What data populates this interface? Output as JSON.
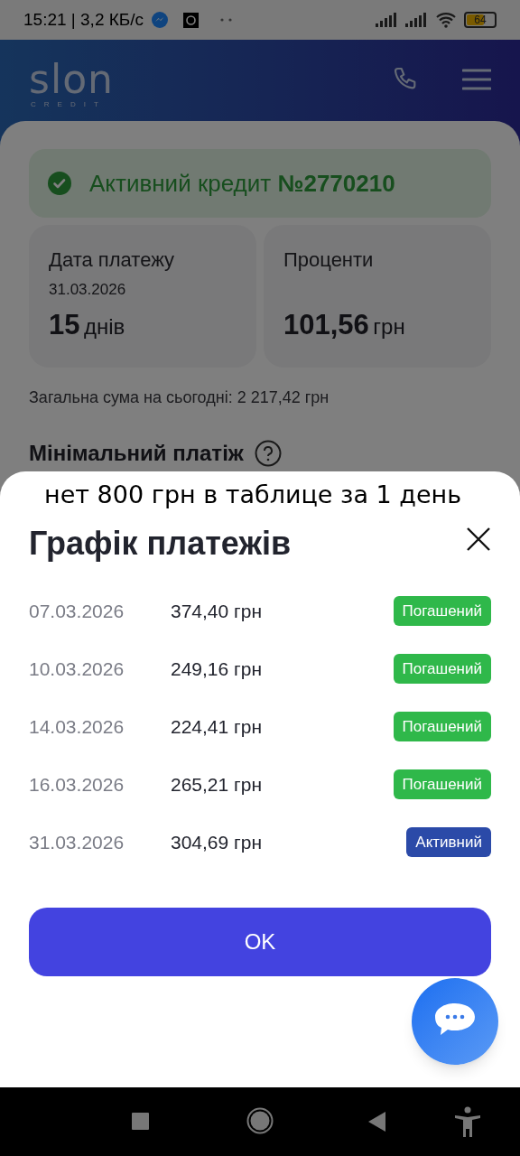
{
  "status_bar": {
    "time": "15:21 | 3,2 КБ/с",
    "battery": "64"
  },
  "header": {
    "logo": "slon",
    "logo_sub": "CREDIT"
  },
  "loan": {
    "label": "Активний кредит",
    "number": "№2770210"
  },
  "cards": [
    {
      "title": "Дата платежу",
      "subtitle": "31.03.2026",
      "value": "15",
      "unit": "днів"
    },
    {
      "title": "Проценти",
      "value": "101,56",
      "unit": "грн"
    }
  ],
  "total": "Загальна сума на сьогодні: 2 217,42 грн",
  "section_title": "Мінімальний платіж",
  "sheet": {
    "annotation": "нет 800 грн в таблице за  1 день",
    "title": "Графік платежів",
    "rows": [
      {
        "date": "07.03.2026",
        "amount": "374,40 грн",
        "status": "Погашений",
        "kind": "paid"
      },
      {
        "date": "10.03.2026",
        "amount": "249,16 грн",
        "status": "Погашений",
        "kind": "paid"
      },
      {
        "date": "14.03.2026",
        "amount": "224,41 грн",
        "status": "Погашений",
        "kind": "paid"
      },
      {
        "date": "16.03.2026",
        "amount": "265,21 грн",
        "status": "Погашений",
        "kind": "paid"
      },
      {
        "date": "31.03.2026",
        "amount": "304,69 грн",
        "status": "Активний",
        "kind": "active"
      }
    ],
    "button": "OK"
  }
}
